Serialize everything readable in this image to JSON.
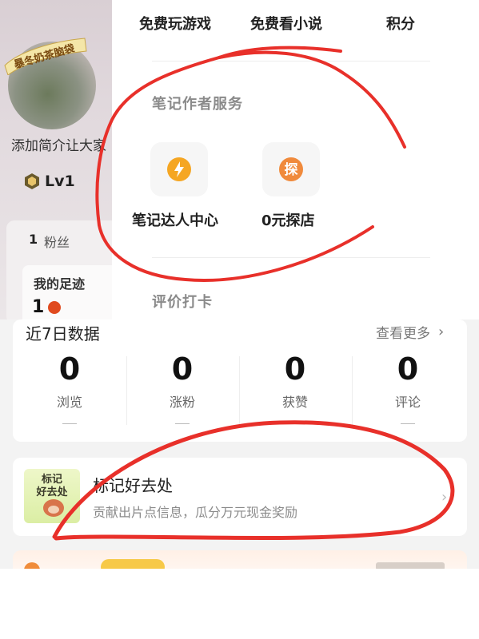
{
  "profile": {
    "avatar_sticker_text": "暴冬奶茶脑袋",
    "bio_text": "添加简介让大家",
    "level": "Lv1",
    "fans": {
      "count": "1",
      "label": "粉丝"
    },
    "footprint": {
      "title": "我的足迹",
      "count": "1"
    }
  },
  "top_menu": {
    "items": [
      {
        "label": "免费玩游戏"
      },
      {
        "label": "免费看小说"
      },
      {
        "label": "积分"
      }
    ]
  },
  "author_services": {
    "title": "笔记作者服务",
    "items": [
      {
        "label": "笔记达人中心",
        "icon": "lightning-icon"
      },
      {
        "label": "0元探店",
        "icon": "explore-shop-icon",
        "icon_char": "探"
      }
    ]
  },
  "review_section": {
    "title": "评价打卡"
  },
  "recent_data": {
    "title": "近7日数据",
    "more": "查看更多",
    "stats": [
      {
        "value": "0",
        "label": "浏览",
        "delta": "—"
      },
      {
        "value": "0",
        "label": "涨粉",
        "delta": "—"
      },
      {
        "value": "0",
        "label": "获赞",
        "delta": "—"
      },
      {
        "value": "0",
        "label": "评论",
        "delta": "—"
      }
    ]
  },
  "place_card": {
    "thumb_line1": "标记",
    "thumb_line2": "好去处",
    "title": "标记好去处",
    "subtitle": "贡献出片点信息，瓜分万元现金奖励"
  },
  "colors": {
    "accent_orange": "#f5a623",
    "explore_orange": "#f08a3c",
    "scribble_red": "#e8302a"
  }
}
